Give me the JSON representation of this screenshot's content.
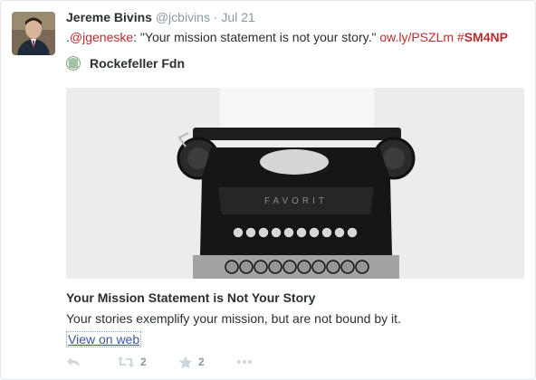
{
  "tweet": {
    "fullname": "Jereme Bivins",
    "handle": "@jcbivins",
    "separator": "·",
    "time": "Jul 21",
    "text_prefix": ".",
    "mention": "@jgeneske",
    "text_body": ": \"Your mission statement is not your story.\" ",
    "url": "ow.ly/PSZLm",
    "hashtag_symbol": "#",
    "hashtag_text": "SM4NP"
  },
  "card": {
    "source_name": "Rockefeller Fdn",
    "title": "Your Mission Statement is Not Your Story",
    "description": "Your stories exemplify your mission, but are not bound by it.",
    "view_on_web": "View on web"
  },
  "actions": {
    "retweet_count": "2",
    "favorite_count": "2"
  },
  "colors": {
    "link": "#bb2c2c",
    "muted": "#8899a6",
    "action_icon": "#ccd6dd"
  }
}
